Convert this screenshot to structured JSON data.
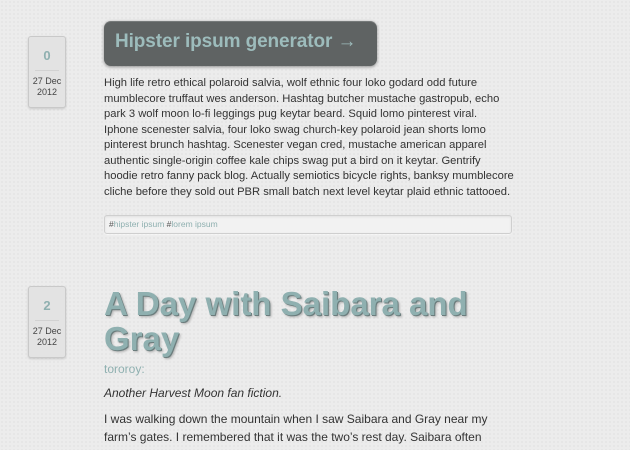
{
  "posts": [
    {
      "note_count": "0",
      "date_day": "27 Dec",
      "date_year": "2012",
      "title": "Hipster ipsum generator →",
      "body": "High life retro ethical polaroid salvia, wolf ethnic four loko godard odd future mumblecore truffaut wes anderson. Hashtag butcher mustache gastropub, echo park 3 wolf moon lo-fi leggings pug keytar beard. Squid lomo pinterest viral. Iphone scenester salvia, four loko swag church-key polaroid jean shorts lomo pinterest brunch hashtag. Scenester vegan cred, mustache american apparel authentic single-origin coffee kale chips swag put a bird on it keytar. Gentrify hoodie retro fanny pack blog. Actually semiotics bicycle rights, banksy mumblecore cliche before they sold out PBR small batch next level keytar plaid ethnic tattooed.",
      "tags": [
        "hipster ipsum",
        "lorem ipsum"
      ],
      "tag_prefix": "#"
    },
    {
      "note_count": "2",
      "date_day": "27 Dec",
      "date_year": "2012",
      "title": "A Day with Saibara and Gray",
      "author": "tororoy:",
      "subtitle": "Another Harvest Moon fan fiction.",
      "body": "I was walking down the mountain when I saw Saibara and Gray near my farm’s gates. I remembered that it was the two’s rest day. Saibara often"
    }
  ],
  "colors": {
    "accent": "#8fb0b0",
    "title_box": "#5f6363",
    "background": "#ececec"
  }
}
